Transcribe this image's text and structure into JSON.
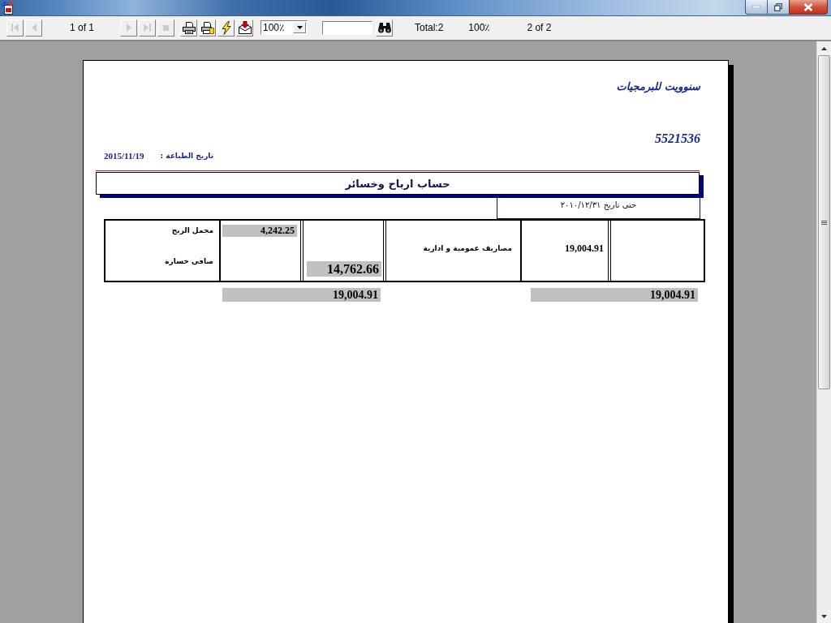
{
  "toolbar": {
    "nav_back": [
      {
        "kind": "first",
        "disabled": true
      },
      {
        "kind": "previous",
        "disabled": true
      }
    ],
    "page_label": "1 of 1",
    "nav_forward": [
      {
        "kind": "next",
        "disabled": true
      },
      {
        "kind": "last",
        "disabled": true
      },
      {
        "kind": "stop",
        "disabled": true
      }
    ],
    "actions": [
      {
        "kind": "print",
        "disabled": false
      },
      {
        "kind": "print_setup",
        "disabled": false
      },
      {
        "kind": "refresh",
        "disabled": false
      },
      {
        "kind": "export",
        "disabled": false
      }
    ],
    "zoom": "100٪",
    "total_count": "Total:2",
    "zoom_level": "100٪",
    "page_count": "2 of 2"
  },
  "report": {
    "company": "سنوويت للبرمجيات",
    "number": "5521536",
    "print_date_label": "تاريخ الطباعة :",
    "print_date": "2015/11/19",
    "title": "حساب ارباح وخسائر",
    "period": "حتى تاريخ ٢٠١٠/١٢/٣١",
    "revenues": {
      "gross_profit_label": "مجمل الربح",
      "gross_profit": "4,242.25",
      "net_loss_label": "صافى خسارة",
      "net_loss": "14,762.66",
      "total": "19,004.91"
    },
    "expenses": {
      "label": "مصاريف عمومية و ادارية",
      "amount": "19,004.91",
      "total": "19,004.91"
    }
  }
}
